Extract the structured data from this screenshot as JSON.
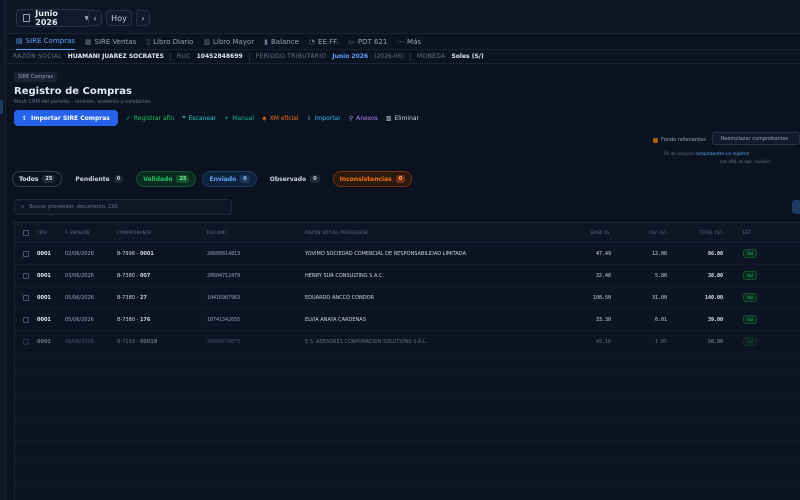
{
  "topbar": {
    "period_label": "Junio 2026",
    "prev_label": "‹",
    "today_label": "Hoy",
    "next_label": "›"
  },
  "tabs": [
    {
      "label": "SIRE Compras",
      "icon": "document-icon",
      "active": true
    },
    {
      "label": "SIRE Ventas",
      "icon": "receipt-icon",
      "active": false
    },
    {
      "label": "Libro Diario",
      "icon": "book-icon",
      "active": false
    },
    {
      "label": "Libro Mayor",
      "icon": "books-icon",
      "active": false
    },
    {
      "label": "Balance",
      "icon": "bar-chart-icon",
      "active": false
    },
    {
      "label": "EE.FF.",
      "icon": "pie-chart-icon",
      "active": false
    },
    {
      "label": "PDT 621",
      "icon": "file-icon",
      "active": false
    },
    {
      "label": "Más",
      "icon": "more-icon",
      "active": false
    }
  ],
  "info": {
    "razon_label": "RAZÓN SOCIAL",
    "razon_value": "HUAMANI JUAREZ SOCRATES",
    "ruc_label": "RUC",
    "ruc_value": "10452848699",
    "periodo_label": "PERÍODO TRIBUTARIO",
    "periodo_value": "Junio 2026",
    "periodo_code": "(2026-06)",
    "moneda_label": "MONEDA",
    "moneda_value": "Soles (S/)"
  },
  "section": {
    "badge": "SIRE Compras",
    "title": "Registro de Compras",
    "subtitle": "Mock CRM del periodo - revisión, sustento y validación"
  },
  "actions": {
    "primary": "Importar SIRE Compras",
    "items": [
      {
        "label": "Registrar afín",
        "tone": "green"
      },
      {
        "label": "Escanear",
        "tone": "teal"
      },
      {
        "label": "Manual",
        "tone": "emerald"
      },
      {
        "label": "XM eficial",
        "tone": "orange"
      },
      {
        "label": "Importar",
        "tone": "sky"
      },
      {
        "label": "Anexos",
        "tone": "violet"
      },
      {
        "label": "Eliminar",
        "tone": "gray"
      }
    ]
  },
  "right_panel": {
    "check_label": "Fondo rellenantes",
    "button_label": "Reemplazar comprobantes",
    "note1_prefix": "1% de compras",
    "note1_link": "comprobantes sin registrar",
    "note2": "con XML de ago. revisión"
  },
  "filters": [
    {
      "label": "Todos",
      "count": "25",
      "style": "all"
    },
    {
      "label": "Pendiente",
      "count": "0",
      "style": "plain"
    },
    {
      "label": "Validado",
      "count": "25",
      "style": "green"
    },
    {
      "label": "Enviado",
      "count": "0",
      "style": "blue"
    },
    {
      "label": "Observado",
      "count": "0",
      "style": "plain"
    },
    {
      "label": "Inconsistencias",
      "count": "0",
      "style": "orange"
    }
  ],
  "search": {
    "placeholder": "Buscar proveedor, documento, CIIS"
  },
  "table": {
    "headers": [
      "TIPO",
      "F. EMISIÓN",
      "COMPROBANTE",
      "RUC/DNI",
      "RAZÓN SOCIAL PROVEEDOR",
      "BASE IG.",
      "IGV (S/)",
      "TOTAL (S/)",
      "EST."
    ],
    "rows": [
      {
        "tipo": "0001",
        "fecha": "02/06/2026",
        "serie": "B-7998",
        "numero": "0001",
        "ruc": "20600814813",
        "razon": "YOVIMO SOCIEDAD COMERCIAL DE RESPONSABILIDAD LIMITADA",
        "base": "47.49",
        "igv": "12.00",
        "total": "86.00",
        "estado": "Val"
      },
      {
        "tipo": "0001",
        "fecha": "03/06/2026",
        "serie": "B-7380",
        "numero": "007",
        "ruc": "20604712479",
        "razon": "HENRY SUR CONSULTING S.A.C.",
        "base": "32.48",
        "igv": "5.80",
        "total": "38.00",
        "estado": "Val"
      },
      {
        "tipo": "0001",
        "fecha": "05/06/2026",
        "serie": "B-7380",
        "numero": "27",
        "ruc": "10416987963",
        "razon": "EDUARDO ANCCO CONDOR",
        "base": "108.50",
        "igv": "31.00",
        "total": "140.00",
        "estado": "Val"
      },
      {
        "tipo": "0001",
        "fecha": "05/06/2026",
        "serie": "B-7380",
        "numero": "176",
        "ruc": "10741342655",
        "razon": "ELVIA ANAYA CARDENAS",
        "base": "33.30",
        "igv": "6.01",
        "total": "39.00",
        "estado": "Val"
      },
      {
        "tipo": "0001",
        "fecha": "06/06/2026",
        "serie": "B-7159",
        "numero": "00018",
        "ruc": "20604729075",
        "razon": "E.S. ASESORES CORPORACION SOLUTIONS S.R.L.",
        "base": "49.16",
        "igv": "1.05",
        "total": "50.00",
        "estado": "Val"
      }
    ]
  }
}
